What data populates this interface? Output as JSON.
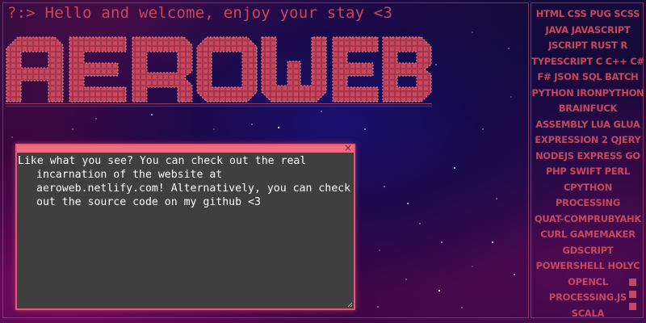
{
  "page": {
    "greeting": "?:> Hello and welcome, enjoy your stay <3",
    "logo_text": "AEROWEB"
  },
  "window": {
    "close_icon": "×",
    "body_text": "Like what you see? You can check out the real incarnation of the website at aeroweb.netlify.com! Alternatively, you can check out the source code on my github <3"
  },
  "languages": [
    "HTML CSS PUG SCSS",
    "JAVA  JAVASCRIPT",
    "JSCRIPT  RUST  R",
    "TYPESCRIPT C C++ C#",
    "F# JSON SQL BATCH",
    "PYTHON IRONPYTHON",
    "BRAINFUCK",
    "ASSEMBLY LUA GLUA",
    "EXPRESSION 2 QJERY",
    "NODEJS EXPRESS GO",
    "PHP  SWIFT  PERL",
    "CPYTHON",
    "PROCESSING",
    "QUAT-COMPRUBYAHK",
    "CURL  GAMEMAKER",
    "GDSCRIPT",
    "POWERSHELL HOLYC",
    "OPENCL",
    "PROCESSING.JS",
    "SCALA"
  ],
  "colors": {
    "accent": "#c8475d",
    "window_border": "#e05a74",
    "window_titlebar": "#f06c80",
    "window_bg": "#3f3f3f",
    "text": "#ffffff"
  }
}
